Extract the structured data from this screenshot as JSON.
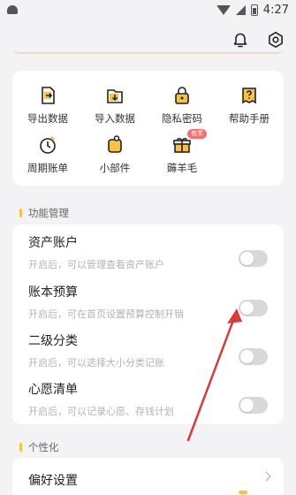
{
  "status_bar": {
    "time": "4:27"
  },
  "header": {
    "notification_icon": "bell-icon",
    "settings_icon": "gear-icon"
  },
  "tools": [
    {
      "label": "导出数据",
      "icon": "export-icon"
    },
    {
      "label": "导入数据",
      "icon": "import-icon"
    },
    {
      "label": "隐私密码",
      "icon": "lock-icon"
    },
    {
      "label": "帮助手册",
      "icon": "help-icon"
    },
    {
      "label": "周期账单",
      "icon": "cycle-icon"
    },
    {
      "label": "小部件",
      "icon": "widget-icon"
    },
    {
      "label": "薅羊毛",
      "icon": "gift-icon",
      "badge": "有奖"
    }
  ],
  "sections": {
    "features": "功能管理",
    "personalization": "个性化"
  },
  "features": [
    {
      "title": "资产账户",
      "desc": "开启后，可以管理查看资产账户",
      "enabled": false
    },
    {
      "title": "账本预算",
      "desc": "开启后，可在首页设置预算控制开销",
      "enabled": false
    },
    {
      "title": "二级分类",
      "desc": "开启后，可以选择大小分类记账",
      "enabled": false
    },
    {
      "title": "心愿清单",
      "desc": "开启后，可以记录心愿、存钱计划",
      "enabled": false
    }
  ],
  "preferences": {
    "label": "偏好设置"
  },
  "colors": {
    "accent": "#f5c246",
    "annotation": "#d93a3a",
    "badge": "#f46f70"
  }
}
